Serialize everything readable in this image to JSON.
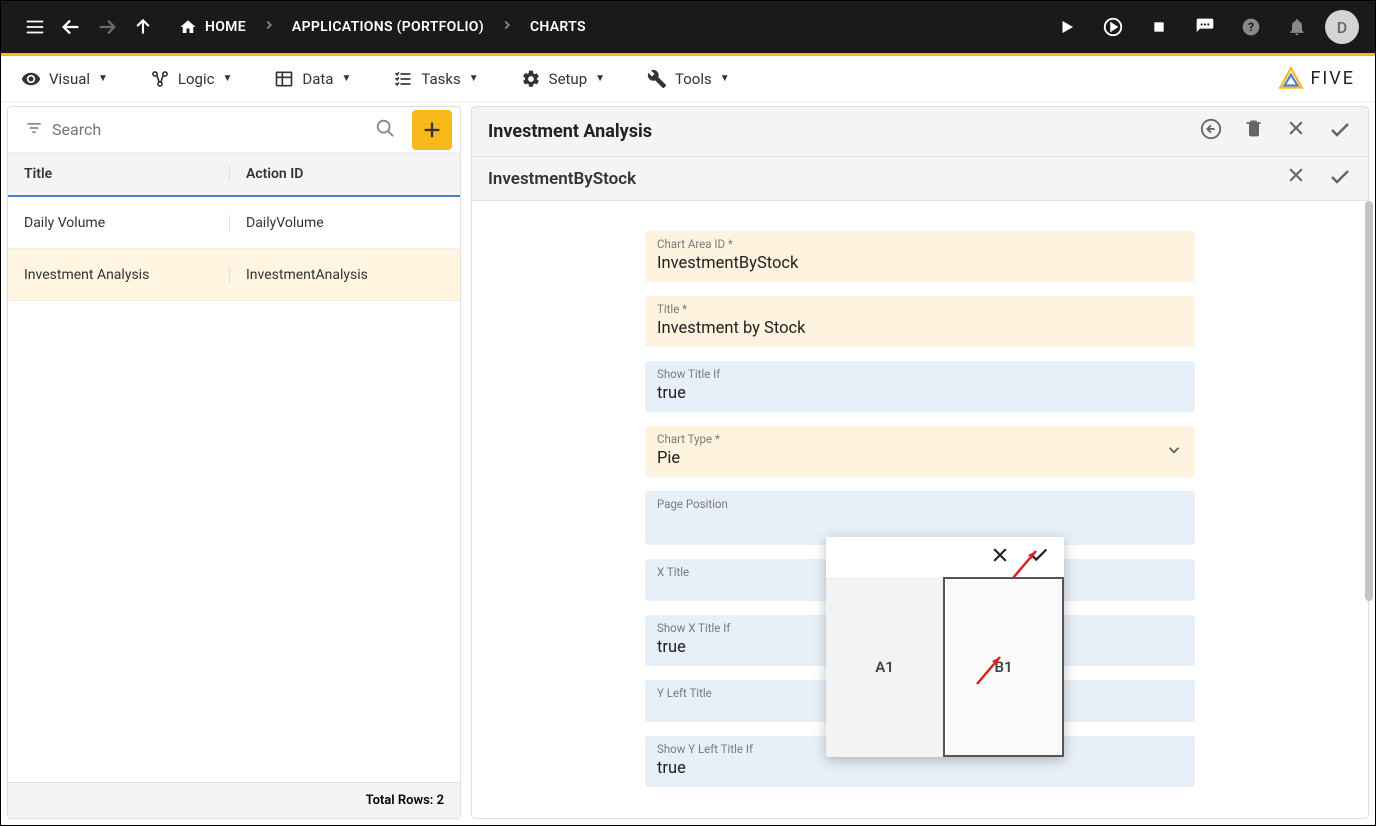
{
  "header": {
    "breadcrumbs": [
      "HOME",
      "APPLICATIONS (PORTFOLIO)",
      "CHARTS"
    ],
    "avatar_letter": "D"
  },
  "menubar": {
    "items": [
      "Visual",
      "Logic",
      "Data",
      "Tasks",
      "Setup",
      "Tools"
    ],
    "logo_text": "FIVE"
  },
  "left": {
    "search_placeholder": "Search",
    "columns": {
      "title": "Title",
      "action": "Action ID"
    },
    "rows": [
      {
        "title": "Daily Volume",
        "action": "DailyVolume",
        "selected": false
      },
      {
        "title": "Investment Analysis",
        "action": "InvestmentAnalysis",
        "selected": true
      }
    ],
    "footer": "Total Rows: 2"
  },
  "detail": {
    "title": "Investment Analysis",
    "sub_title": "InvestmentByStock",
    "fields": {
      "chart_area_id": {
        "label": "Chart Area ID *",
        "value": "InvestmentByStock"
      },
      "title": {
        "label": "Title *",
        "value": "Investment by Stock"
      },
      "show_title_if": {
        "label": "Show Title If",
        "value": "true"
      },
      "chart_type": {
        "label": "Chart Type *",
        "value": "Pie"
      },
      "page_position": {
        "label": "Page Position",
        "value": ""
      },
      "x_title": {
        "label": "X Title",
        "value": ""
      },
      "show_x_title_if": {
        "label": "Show X Title If",
        "value": "true"
      },
      "y_left_title": {
        "label": "Y Left Title",
        "value": ""
      },
      "show_y_left_title_if": {
        "label": "Show Y Left Title If",
        "value": "true"
      }
    }
  },
  "popup": {
    "cell_a": "A1",
    "cell_b": "B1"
  }
}
